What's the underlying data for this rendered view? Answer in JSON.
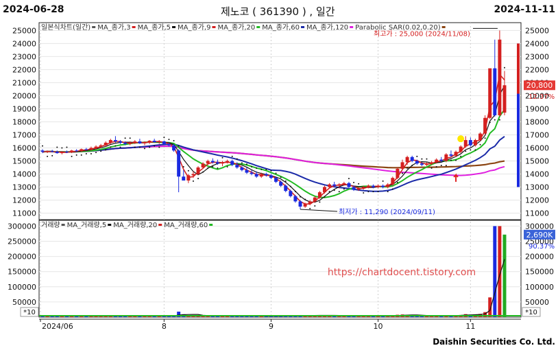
{
  "header": {
    "start_date": "2024-06-28",
    "title": "제노코 ( 361390 ) , 일간",
    "end_date": "2024-11-11"
  },
  "legend_price": [
    {
      "text": "일본식차트(일간)",
      "color": "#555555"
    },
    {
      "text": "MA_종가,3",
      "color": "#d42020"
    },
    {
      "text": "MA_종가,5",
      "color": "#111111"
    },
    {
      "text": "MA_종가,9",
      "color": "#d42020"
    },
    {
      "text": "MA_종가,20",
      "color": "#22bb22"
    },
    {
      "text": "MA_종가,60",
      "color": "#1a2aa8"
    },
    {
      "text": "MA_종가,120",
      "color": "#e020e0"
    },
    {
      "text": "Parabolic SAR(0.02,0.20)",
      "color": "#8b4513"
    }
  ],
  "legend_volume": [
    {
      "text": "거래량",
      "color": "#555555"
    },
    {
      "text": "MA_거래량,5",
      "color": "#111111"
    },
    {
      "text": "MA_거래량,20",
      "color": "#d42020"
    },
    {
      "text": "MA_거래량,60",
      "color": "#22bb22"
    }
  ],
  "annotations": {
    "high": "최고가 : 25,000 (2024/11/08)",
    "low": "최저가 : 11,290 (2024/09/11)",
    "last_price": "20,800",
    "last_pct": "12.37%",
    "last_volume": "2,690K",
    "volume_pct": "90.37%",
    "price_scale_tag": "",
    "volume_scale_tag": "*10",
    "watermark": "https://chartdocent.tistory.com"
  },
  "footer": "Daishin Securities Co. Ltd.",
  "chart_data": {
    "type": "candlestick",
    "x_labels": [
      "2024/06",
      "8",
      "9",
      "10",
      "11"
    ],
    "price_axis": {
      "ticks": [
        11000,
        12000,
        13000,
        14000,
        15000,
        16000,
        17000,
        18000,
        19000,
        20000,
        21000,
        22000,
        23000,
        24000,
        25000
      ],
      "ylim": [
        10500,
        25600
      ]
    },
    "volume_axis": {
      "ticks": [
        50000,
        100000,
        150000,
        200000,
        250000,
        300000
      ],
      "ylim": [
        0,
        310000
      ]
    },
    "candles": [
      [
        15800,
        15900,
        15600,
        15700
      ],
      [
        15700,
        15800,
        15600,
        15750
      ],
      [
        15750,
        15850,
        15650,
        15700
      ],
      [
        15700,
        15800,
        15550,
        15600
      ],
      [
        15600,
        15750,
        15500,
        15700
      ],
      [
        15700,
        15800,
        15600,
        15650
      ],
      [
        15650,
        15850,
        15600,
        15800
      ],
      [
        15800,
        15900,
        15700,
        15750
      ],
      [
        15750,
        15950,
        15700,
        15900
      ],
      [
        15900,
        16000,
        15800,
        15850
      ],
      [
        15850,
        16100,
        15800,
        16000
      ],
      [
        16000,
        16200,
        15900,
        16100
      ],
      [
        16100,
        16300,
        16000,
        16200
      ],
      [
        16200,
        16500,
        16100,
        16400
      ],
      [
        16400,
        16700,
        16300,
        16600
      ],
      [
        16600,
        16900,
        16400,
        16500
      ],
      [
        16500,
        16600,
        16300,
        16400
      ],
      [
        16400,
        16500,
        16200,
        16300
      ],
      [
        16300,
        16500,
        16200,
        16400
      ],
      [
        16400,
        16600,
        16300,
        16500
      ],
      [
        16500,
        16700,
        16300,
        16350
      ],
      [
        16350,
        16500,
        16200,
        16400
      ],
      [
        16400,
        16600,
        16300,
        16550
      ],
      [
        16550,
        16700,
        16400,
        16450
      ],
      [
        16450,
        16600,
        16300,
        16500
      ],
      [
        16500,
        16550,
        16200,
        16300
      ],
      [
        16300,
        16400,
        16100,
        16200
      ],
      [
        16200,
        16300,
        15700,
        15800
      ],
      [
        15800,
        15900,
        12600,
        13800
      ],
      [
        13800,
        14300,
        13500,
        13500
      ],
      [
        13500,
        14000,
        13300,
        13900
      ],
      [
        13900,
        14200,
        13700,
        14000
      ],
      [
        14000,
        14600,
        13900,
        14500
      ],
      [
        14500,
        14900,
        14400,
        14800
      ],
      [
        14800,
        15100,
        14700,
        15000
      ],
      [
        15000,
        15200,
        14800,
        14900
      ],
      [
        14900,
        15100,
        14700,
        14800
      ],
      [
        14800,
        15000,
        14600,
        14900
      ],
      [
        14900,
        15100,
        14800,
        15000
      ],
      [
        15000,
        15100,
        14600,
        14700
      ],
      [
        14700,
        14900,
        14400,
        14500
      ],
      [
        14500,
        14600,
        14200,
        14300
      ],
      [
        14300,
        14500,
        14000,
        14100
      ],
      [
        14100,
        14300,
        13900,
        14000
      ],
      [
        14000,
        14200,
        13700,
        13800
      ],
      [
        13800,
        14100,
        13700,
        14000
      ],
      [
        14000,
        14100,
        13800,
        13900
      ],
      [
        13900,
        14000,
        13600,
        13700
      ],
      [
        13700,
        13800,
        13300,
        13400
      ],
      [
        13400,
        13500,
        13000,
        13100
      ],
      [
        13100,
        13200,
        12600,
        12700
      ],
      [
        12700,
        12800,
        12200,
        12300
      ],
      [
        12300,
        12400,
        11800,
        11900
      ],
      [
        11900,
        12000,
        11290,
        11500
      ],
      [
        11500,
        11800,
        11400,
        11700
      ],
      [
        11700,
        12000,
        11600,
        11900
      ],
      [
        11900,
        12300,
        11800,
        12200
      ],
      [
        12200,
        12700,
        12100,
        12600
      ],
      [
        12600,
        13100,
        12500,
        13000
      ],
      [
        13000,
        13300,
        12900,
        13200
      ],
      [
        13200,
        13400,
        13000,
        13100
      ],
      [
        13100,
        13300,
        12900,
        13200
      ],
      [
        13200,
        13400,
        13100,
        13300
      ],
      [
        13300,
        13400,
        12900,
        13000
      ],
      [
        13000,
        13100,
        12700,
        12800
      ],
      [
        12800,
        13000,
        12700,
        12900
      ],
      [
        12900,
        13100,
        12800,
        13000
      ],
      [
        13000,
        13200,
        12900,
        13100
      ],
      [
        13100,
        13200,
        12900,
        13000
      ],
      [
        13000,
        13200,
        12900,
        13100
      ],
      [
        13100,
        13200,
        12900,
        13000
      ],
      [
        13000,
        13300,
        12900,
        13200
      ],
      [
        13200,
        13800,
        13100,
        13700
      ],
      [
        13700,
        14500,
        13600,
        14400
      ],
      [
        14400,
        15100,
        14300,
        14900
      ],
      [
        14900,
        15400,
        14700,
        15300
      ],
      [
        15300,
        15400,
        14900,
        15000
      ],
      [
        15000,
        15100,
        14700,
        14800
      ],
      [
        14800,
        14900,
        14600,
        14700
      ],
      [
        14700,
        14900,
        14600,
        14800
      ],
      [
        14800,
        15000,
        14700,
        14900
      ],
      [
        14900,
        15200,
        14800,
        15100
      ],
      [
        15100,
        15300,
        14900,
        15000
      ],
      [
        15000,
        15600,
        14900,
        15500
      ],
      [
        15500,
        15800,
        15300,
        15400
      ],
      [
        15400,
        15800,
        15300,
        15700
      ],
      [
        15700,
        16200,
        15600,
        16100
      ],
      [
        16100,
        16900,
        16000,
        16600
      ],
      [
        16600,
        16800,
        16100,
        16200
      ],
      [
        16200,
        16700,
        16100,
        16600
      ],
      [
        16600,
        17200,
        16500,
        17100
      ],
      [
        17100,
        18500,
        17000,
        18300
      ],
      [
        18300,
        22100,
        18200,
        22100
      ],
      [
        22100,
        24300,
        18400,
        18500
      ],
      [
        18500,
        25000,
        18400,
        24300
      ],
      [
        18700,
        21900,
        18500,
        20800
      ]
    ],
    "volume_bars": [
      4200,
      3800,
      3600,
      3900,
      3500,
      3700,
      4100,
      3800,
      4000,
      3600,
      4300,
      4500,
      4700,
      5200,
      6100,
      5800,
      4600,
      4200,
      4000,
      4300,
      4500,
      3900,
      4400,
      4100,
      3900,
      3800,
      3600,
      5200,
      18000,
      9500,
      6200,
      5400,
      5100,
      4800,
      4600,
      4300,
      4100,
      3900,
      3800,
      4000,
      3900,
      3700,
      3600,
      3500,
      3400,
      3500,
      3300,
      3200,
      3600,
      3800,
      4200,
      4600,
      5000,
      6800,
      5200,
      4800,
      5500,
      6000,
      6400,
      5800,
      4900,
      4600,
      4400,
      4300,
      4100,
      3900,
      3800,
      3700,
      3600,
      3500,
      3600,
      3800,
      5200,
      7800,
      8600,
      7200,
      6000,
      5100,
      4700,
      4500,
      4400,
      4600,
      4800,
      5500,
      5200,
      5900,
      7200,
      9800,
      8200,
      8000,
      10500,
      16500,
      65000,
      300000,
      300000,
      272000
    ]
  }
}
